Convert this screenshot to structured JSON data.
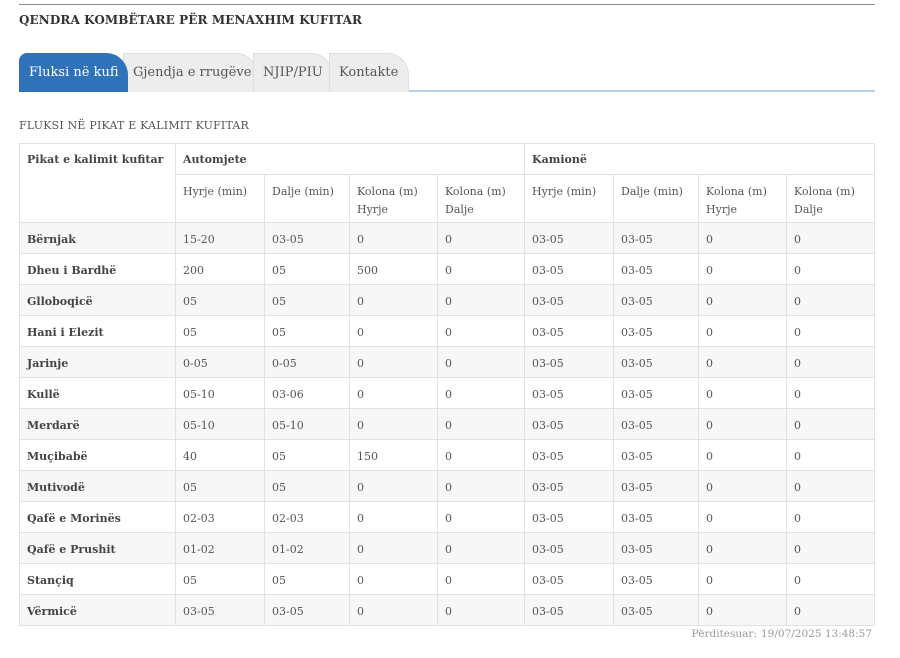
{
  "header": {
    "site_title": "QENDRA KOMBËTARE PËR MENAXHIM KUFITAR"
  },
  "tabs": [
    {
      "label": "Fluksi në kufi",
      "active": true
    },
    {
      "label": "Gjendja e rrugëve",
      "active": false
    },
    {
      "label": "NJIP/PIU",
      "active": false
    },
    {
      "label": "Kontakte",
      "active": false
    }
  ],
  "section": {
    "title": "FLUKSI NË PIKAT E KALIMIT KUFITAR"
  },
  "table": {
    "corner": "Pikat e kalimit kufitar",
    "groups": [
      "Automjete",
      "Kamionë"
    ],
    "subheaders": [
      "Hyrje (min)",
      "Dalje (min)",
      "Kolona (m) Hyrje",
      "Kolona (m) Dalje",
      "Hyrje (min)",
      "Dalje (min)",
      "Kolona (m) Hyrje",
      "Kolona (m) Dalje"
    ],
    "rows": [
      [
        "Bërnjak",
        "15-20",
        "03-05",
        "0",
        "0",
        "03-05",
        "03-05",
        "0",
        "0"
      ],
      [
        "Dheu i Bardhë",
        "200",
        "05",
        "500",
        "0",
        "03-05",
        "03-05",
        "0",
        "0"
      ],
      [
        "Glloboqicë",
        "05",
        "05",
        "0",
        "0",
        "03-05",
        "03-05",
        "0",
        "0"
      ],
      [
        "Hani i Elezit",
        "05",
        "05",
        "0",
        "0",
        "03-05",
        "03-05",
        "0",
        "0"
      ],
      [
        "Jarinje",
        "0-05",
        "0-05",
        "0",
        "0",
        "03-05",
        "03-05",
        "0",
        "0"
      ],
      [
        "Kullë",
        "05-10",
        "03-06",
        "0",
        "0",
        "03-05",
        "03-05",
        "0",
        "0"
      ],
      [
        "Merdarë",
        "05-10",
        "05-10",
        "0",
        "0",
        "03-05",
        "03-05",
        "0",
        "0"
      ],
      [
        "Muçibabë",
        "40",
        "05",
        "150",
        "0",
        "03-05",
        "03-05",
        "0",
        "0"
      ],
      [
        "Mutivodë",
        "05",
        "05",
        "0",
        "0",
        "03-05",
        "03-05",
        "0",
        "0"
      ],
      [
        "Qafë e Morinës",
        "02-03",
        "02-03",
        "0",
        "0",
        "03-05",
        "03-05",
        "0",
        "0"
      ],
      [
        "Qafë e Prushit",
        "01-02",
        "01-02",
        "0",
        "0",
        "03-05",
        "03-05",
        "0",
        "0"
      ],
      [
        "Stançiq",
        "05",
        "05",
        "0",
        "0",
        "03-05",
        "03-05",
        "0",
        "0"
      ],
      [
        "Vërmicë",
        "03-05",
        "03-05",
        "0",
        "0",
        "03-05",
        "03-05",
        "0",
        "0"
      ]
    ]
  },
  "footer": {
    "updated_label": "Përditesuar:",
    "updated_value": "19/07/2025 13:48:57"
  },
  "colors": {
    "accent": "#2f72b9",
    "tab_inactive": "#ededed",
    "border": "#e1e1e1"
  }
}
